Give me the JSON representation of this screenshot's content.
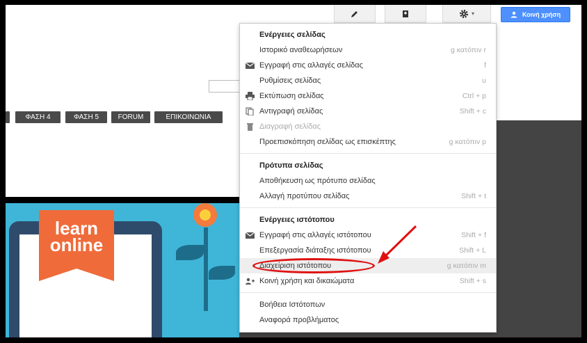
{
  "toolbar": {
    "edit_icon": "pencil-icon",
    "page_icon": "new-page-icon",
    "settings_icon": "gear-icon",
    "share_label": "Κοινή χρήση"
  },
  "nav": {
    "tabs": [
      "ΦΑΣΗ 4",
      "ΦΑΣΗ 5",
      "FORUM",
      "ΕΠΙΚΟΙΝΩΝΙΑ"
    ]
  },
  "banner": {
    "line1": "learn",
    "line2": "online"
  },
  "menu": {
    "page_actions_header": "Ενέργειες σελίδας",
    "revision_history": {
      "label": "Ιστορικό αναθεωρήσεων",
      "shortcut": "g κατόπιν r"
    },
    "subscribe_page": {
      "label": "Εγγραφή στις αλλαγές σελίδας",
      "shortcut": "f"
    },
    "page_settings": {
      "label": "Ρυθμίσεις σελίδας",
      "shortcut": "u"
    },
    "print_page": {
      "label": "Εκτύπωση σελίδας",
      "shortcut": "Ctrl + p"
    },
    "copy_page": {
      "label": "Αντιγραφή σελίδας",
      "shortcut": "Shift + c"
    },
    "delete_page": {
      "label": "Διαγραφή σελίδας",
      "shortcut": ""
    },
    "preview_visitor": {
      "label": "Προεπισκόπηση σελίδας ως επισκέπτης",
      "shortcut": "g κατόπιν p"
    },
    "templates_header": "Πρότυπα σελίδας",
    "save_template": {
      "label": "Αποθήκευση ως πρότυπο σελίδας",
      "shortcut": ""
    },
    "change_template": {
      "label": "Αλλαγή προτύπου σελίδας",
      "shortcut": "Shift + t"
    },
    "site_actions_header": "Ενέργειες ιστότοπου",
    "subscribe_site": {
      "label": "Εγγραφή στις αλλαγές ιστότοπου",
      "shortcut": "Shift + f"
    },
    "edit_layout": {
      "label": "Επεξεργασία διάταξης ιστότοπου",
      "shortcut": "Shift + L"
    },
    "manage_site": {
      "label": "Διαχείριση ιστότοπου",
      "shortcut": "g κατόπιν m"
    },
    "sharing": {
      "label": "Κοινή χρήση και δικαιώματα",
      "shortcut": "Shift + s"
    },
    "sites_help": {
      "label": "Βοήθεια Ιστότοπων",
      "shortcut": ""
    },
    "report_issue": {
      "label": "Αναφορά προβλήματος",
      "shortcut": ""
    }
  },
  "colors": {
    "share_button": "#4d90fe",
    "annotation": "#e01010",
    "nav_tab": "#4a4a4a"
  }
}
